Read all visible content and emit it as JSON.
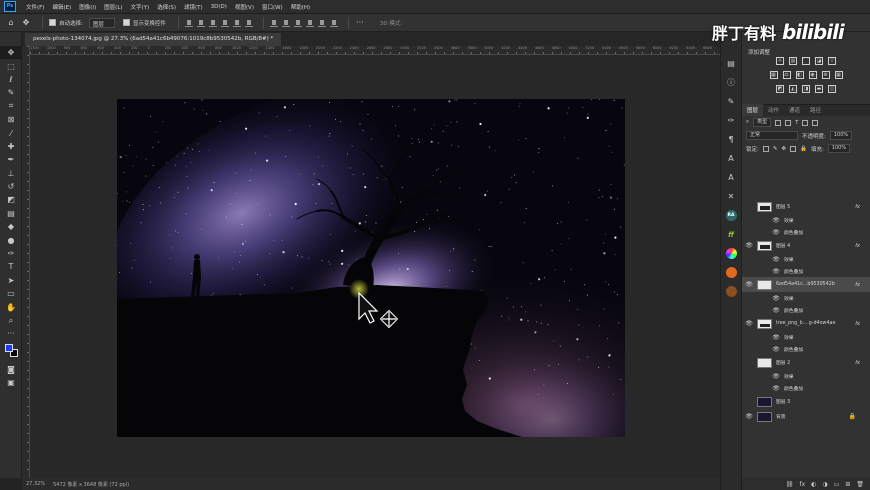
{
  "app": {
    "logo": "Ps"
  },
  "menu": [
    "文件(F)",
    "编辑(E)",
    "图像(I)",
    "图层(L)",
    "文字(Y)",
    "选择(S)",
    "滤镜(T)",
    "3D(D)",
    "视图(V)",
    "窗口(W)",
    "帮助(H)"
  ],
  "options": {
    "auto_select_label": "自动选择:",
    "auto_select_value": "图层",
    "show_transform_label": "显示变换控件",
    "mode_label": "3D 模式:"
  },
  "watermark": {
    "text": "胖丁有料",
    "logo": "bilibili"
  },
  "document": {
    "tab_title": "pexels-photo-134074.jpg @ 27.3% (6ad54a41c6b49076:1019c8b9530542b, RGB/8#) *",
    "zoom": "27.32%",
    "size_info": "5472 像素 x 3648 像素 (72 ppi)"
  },
  "ruler_h": [
    "1300",
    "1000",
    "900",
    "800",
    "600",
    "400",
    "200",
    "0",
    "200",
    "400",
    "600",
    "800",
    "1000",
    "1200",
    "1400",
    "1600",
    "1800",
    "2000",
    "2200",
    "2400",
    "2600",
    "2800",
    "3000",
    "3200",
    "3400",
    "3600",
    "3800",
    "4000",
    "4200",
    "4400",
    "4600",
    "4800",
    "5000",
    "5200",
    "5400",
    "5600",
    "5800",
    "6000",
    "6200",
    "6400",
    "6600"
  ],
  "adjustments": {
    "header": "添加调整"
  },
  "layers_panel": {
    "tabs": [
      "图层",
      "动作",
      "通道",
      "路径"
    ],
    "filter_type": "类型",
    "blend_mode": "正常",
    "opacity_label": "不透明度:",
    "opacity_value": "100%",
    "lock_label": "锁定:",
    "fill_label": "填充:",
    "fill_value": "100%",
    "layers": [
      {
        "name": "图层 5",
        "fx": "fx",
        "effects_label": "效果",
        "effect": "颜色叠加"
      },
      {
        "name": "图层 4",
        "fx": "fx",
        "effects_label": "效果",
        "effect": "颜色叠加"
      },
      {
        "name": "6ad54a41c...b9530542b",
        "fx": "fx",
        "effects_label": "效果",
        "effect": "颜色叠加"
      },
      {
        "name": "tree_png_b....g-d4ow4ae",
        "fx": "fx",
        "effects_label": "效果",
        "effect": "颜色叠加"
      },
      {
        "name": "图层 2",
        "fx": "fx",
        "effects_label": "效果",
        "effect": "颜色叠加"
      },
      {
        "name": "图层 3"
      },
      {
        "name": "背景"
      }
    ]
  }
}
